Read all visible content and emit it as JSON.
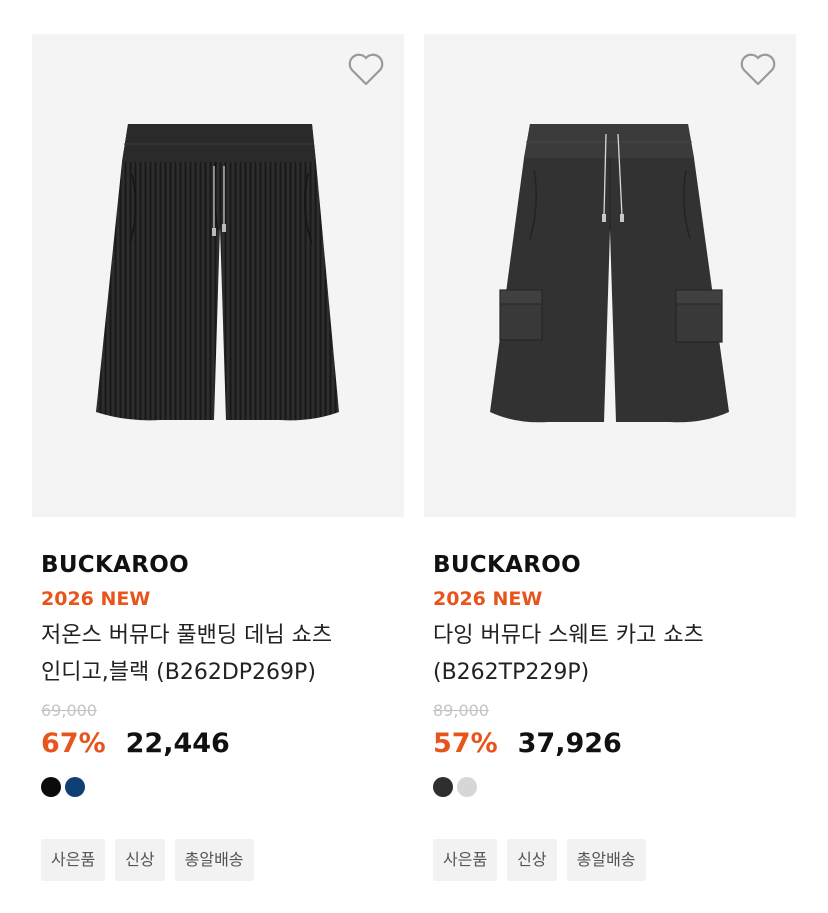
{
  "products": [
    {
      "brand": "BUCKAROO",
      "tag": "2026 NEW",
      "name": "저온스 버뮤다 풀밴딩 데님 쇼츠 인디고,블랙 (B262DP269P)",
      "original_price": "69,000",
      "discount": "67%",
      "price": "22,446",
      "colors": [
        "#0b0b0b",
        "#0f3f73"
      ],
      "badges": [
        "사은품",
        "신상",
        "총알배송"
      ],
      "wishlist_icon": "heart-outline-icon"
    },
    {
      "brand": "BUCKAROO",
      "tag": "2026 NEW",
      "name": "다잉 버뮤다 스웨트 카고 쇼츠 (B262TP229P)",
      "original_price": "89,000",
      "discount": "57%",
      "price": "37,926",
      "colors": [
        "#2e2e2e",
        "#d6d6d6"
      ],
      "badges": [
        "사은품",
        "신상",
        "총알배송"
      ],
      "wishlist_icon": "heart-outline-icon"
    }
  ],
  "accent_color": "#e8551c"
}
